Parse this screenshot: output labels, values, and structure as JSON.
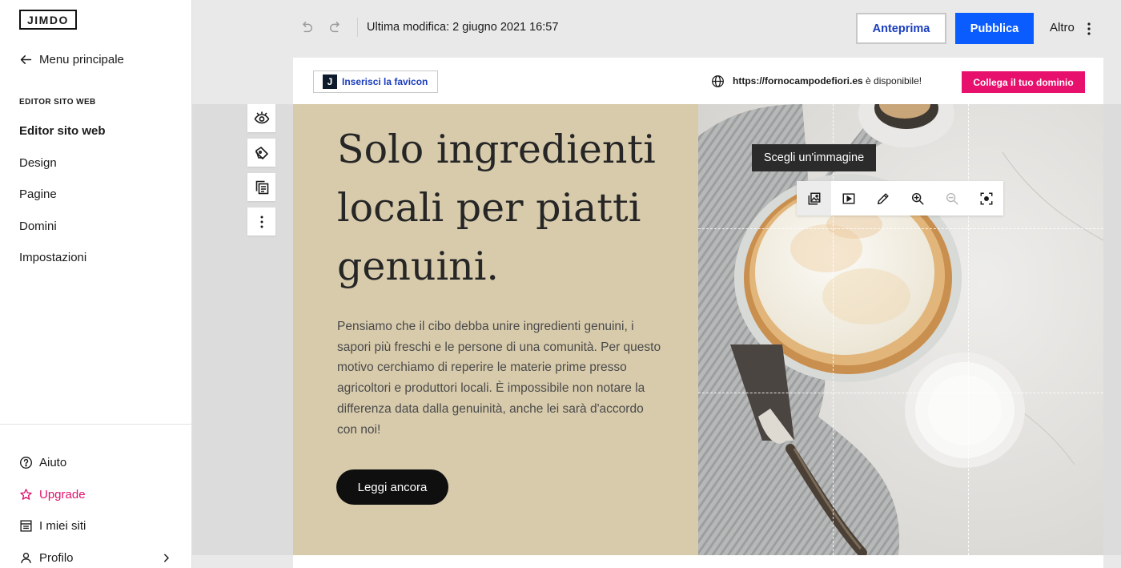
{
  "sidebar": {
    "logo": "JIMDO",
    "back_label": "Menu principale",
    "section_title": "EDITOR SITO WEB",
    "items": [
      {
        "label": "Editor sito web"
      },
      {
        "label": "Design"
      },
      {
        "label": "Pagine"
      },
      {
        "label": "Domini"
      },
      {
        "label": "Impostazioni"
      }
    ],
    "bottom": {
      "help": "Aiuto",
      "upgrade": "Upgrade",
      "sites": "I miei siti",
      "profile": "Profilo"
    }
  },
  "topbar": {
    "last_modified": "Ultima modifica: 2 giugno 2021 16:57",
    "preview": "Anteprima",
    "publish": "Pubblica",
    "more": "Altro"
  },
  "site_header": {
    "favicon_letter": "J",
    "favicon_label": "Inserisci la favicon",
    "domain": "https://fornocampodefiori.es",
    "domain_suffix": " è disponibile!",
    "connect_button": "Collega il tuo dominio"
  },
  "hero": {
    "title": "Solo ingredienti locali per piatti genuini.",
    "text": "Pensiamo che il cibo debba unire ingredienti genuini, i sapori più freschi e le persone di una comunità. Per questo motivo cerchiamo di reperire le materie prime presso agricoltori e produttori locali. È impossibile non notare la differenza data dalla genuinità, anche lei sarà d'accordo con noi!",
    "button": "Leggi ancora",
    "tooltip": "Scegli un'immagine"
  },
  "colors": {
    "accent": "#0b5cff",
    "brand_pink": "#e8106d",
    "hero_bg": "#d8cbac"
  }
}
